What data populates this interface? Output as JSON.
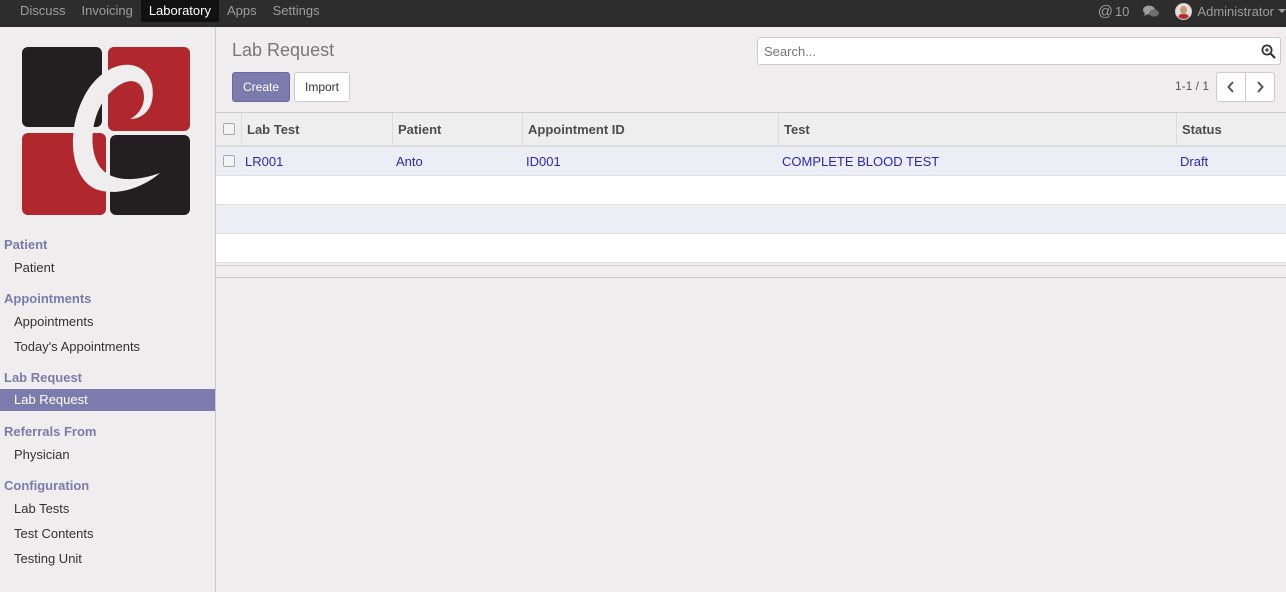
{
  "topbar": {
    "menu": [
      "Discuss",
      "Invoicing",
      "Laboratory",
      "Apps",
      "Settings"
    ],
    "active": "Laboratory",
    "mention_count": "10",
    "mention_symbol": "@",
    "user": "Administrator",
    "icons": {
      "mention": "at-icon",
      "chat": "chat-bubbles-icon",
      "user": "avatar",
      "dropdown": "caret-down-icon"
    }
  },
  "sidebar": {
    "logo_colors": {
      "red": "#b0272d",
      "dark": "#231f20",
      "swoosh": "#efeded"
    },
    "sections": [
      {
        "title": "Patient",
        "items": [
          "Patient"
        ]
      },
      {
        "title": "Appointments",
        "items": [
          "Appointments",
          "Today's Appointments"
        ]
      },
      {
        "title": "Lab Request",
        "items": [
          "Lab Request"
        ]
      },
      {
        "title": "Referrals From",
        "items": [
          "Physician"
        ]
      },
      {
        "title": "Configuration",
        "items": [
          "Lab Tests",
          "Test Contents",
          "Testing Unit"
        ]
      }
    ],
    "active_item": "Lab Request"
  },
  "main": {
    "title": "Lab Request",
    "search_placeholder": "Search...",
    "create_label": "Create",
    "import_label": "Import",
    "pager": "1-1 / 1",
    "table": {
      "columns": [
        "Lab Test",
        "Patient",
        "Appointment ID",
        "Test",
        "Status"
      ],
      "rows": [
        [
          "LR001",
          "Anto",
          "ID001",
          "COMPLETE BLOOD TEST",
          "Draft"
        ]
      ]
    }
  },
  "colors": {
    "accent": "#7c7bad",
    "navbar": "#2d2d2d",
    "link": "#2a2ab0"
  }
}
